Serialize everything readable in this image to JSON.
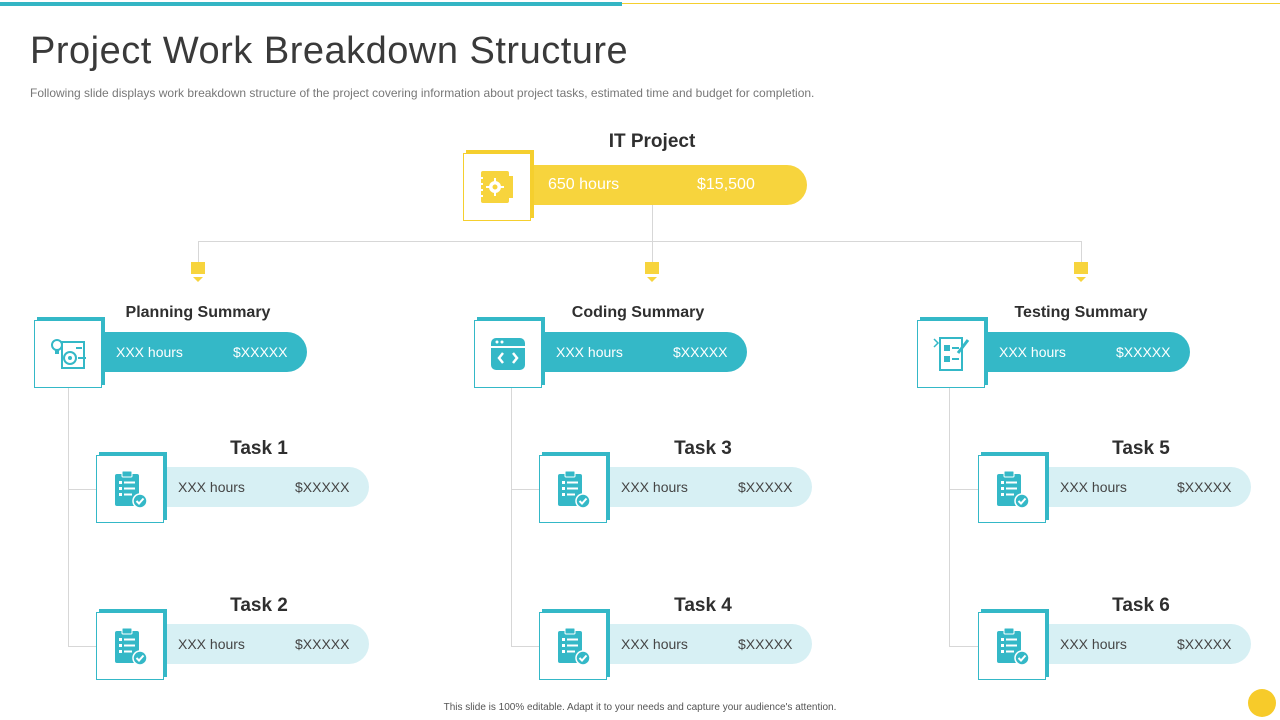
{
  "slide": {
    "title": "Project Work Breakdown Structure",
    "subtitle": "Following slide displays work breakdown structure of the project covering information about project tasks, estimated time and budget for completion.",
    "footer": "This slide is 100% editable. Adapt it to your needs and capture your audience's attention."
  },
  "colors": {
    "teal": "#34b8c7",
    "yellow": "#f7d43d",
    "light_teal": "#d7f0f4"
  },
  "root": {
    "title": "IT Project",
    "hours": "650 hours",
    "budget": "$15,500",
    "icon": "gear-notebook-icon"
  },
  "summaries": [
    {
      "title": "Planning Summary",
      "hours": "XXX   hours",
      "budget": "$XXXXX",
      "icon": "planning-icon"
    },
    {
      "title": "Coding Summary",
      "hours": "XXX   hours",
      "budget": "$XXXXX",
      "icon": "code-window-icon"
    },
    {
      "title": "Testing Summary",
      "hours": "XXX   hours",
      "budget": "$XXXXX",
      "icon": "testing-icon"
    }
  ],
  "tasks": [
    {
      "title": "Task 1",
      "hours": "XXX   hours",
      "budget": "$XXXXX",
      "icon": "clipboard-check-icon"
    },
    {
      "title": "Task 2",
      "hours": "XXX   hours",
      "budget": "$XXXXX",
      "icon": "clipboard-check-icon"
    },
    {
      "title": "Task 3",
      "hours": "XXX   hours",
      "budget": "$XXXXX",
      "icon": "clipboard-check-icon"
    },
    {
      "title": "Task 4",
      "hours": "XXX   hours",
      "budget": "$XXXXX",
      "icon": "clipboard-check-icon"
    },
    {
      "title": "Task 5",
      "hours": "XXX   hours",
      "budget": "$XXXXX",
      "icon": "clipboard-check-icon"
    },
    {
      "title": "Task 6",
      "hours": "XXX   hours",
      "budget": "$XXXXX",
      "icon": "clipboard-check-icon"
    }
  ]
}
